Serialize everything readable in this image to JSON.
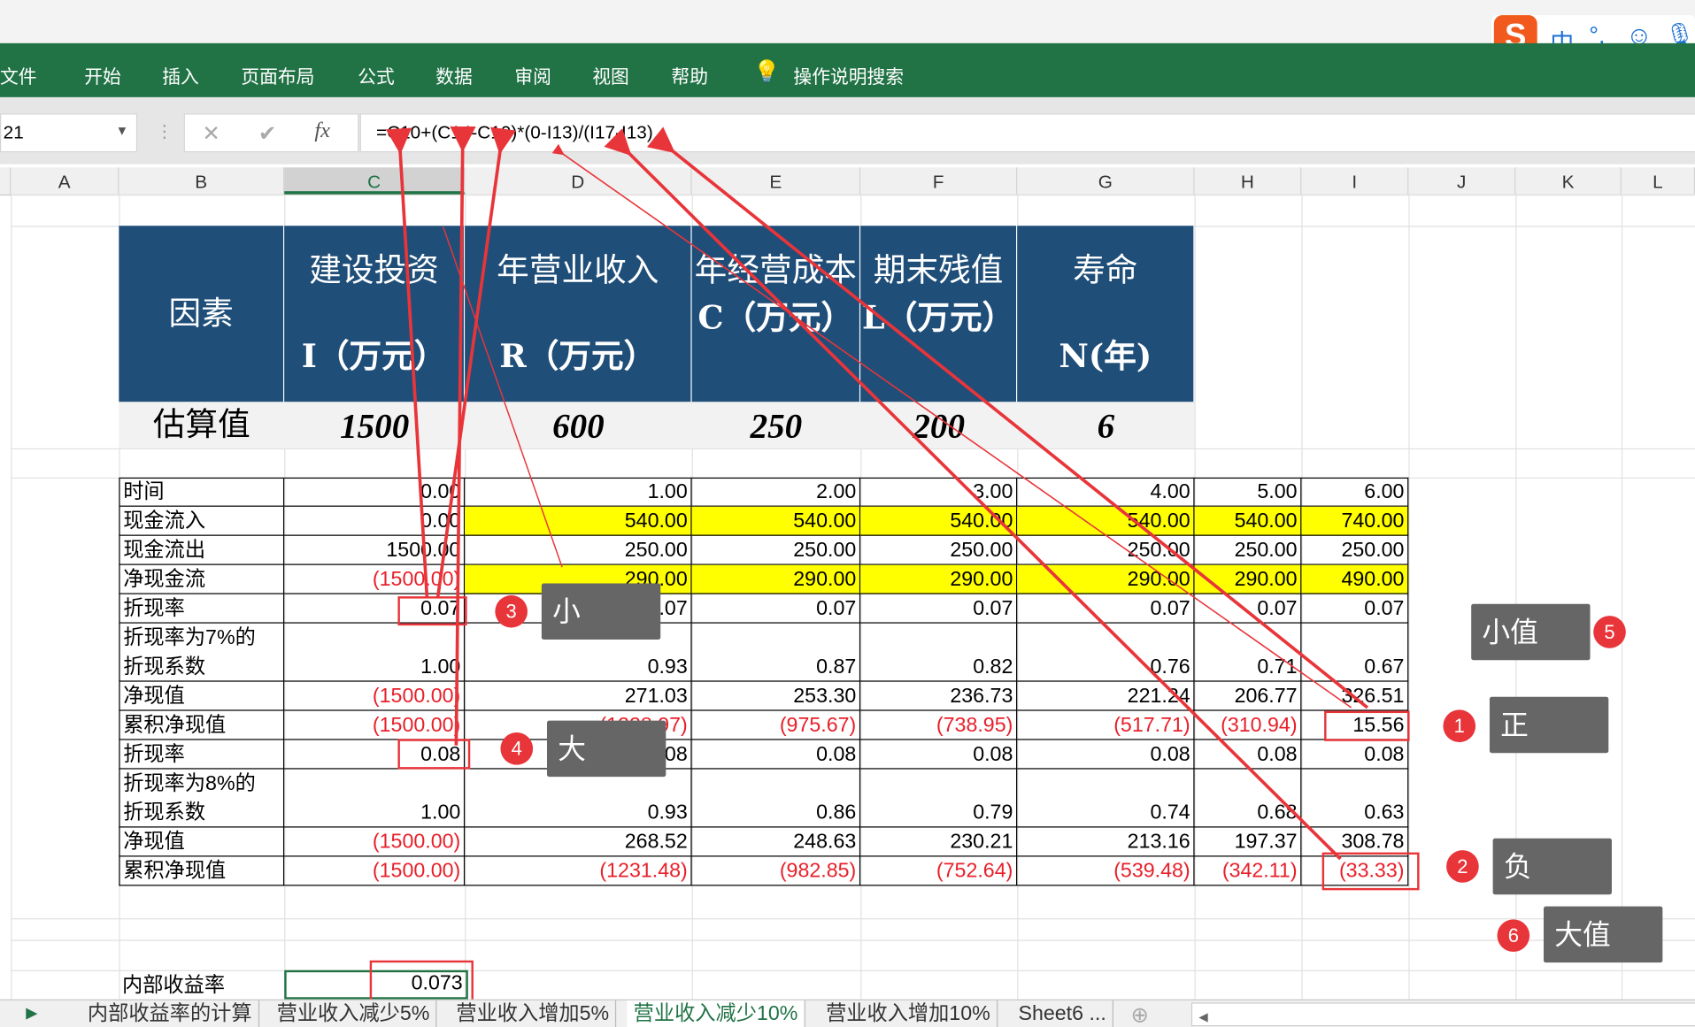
{
  "ribbon": {
    "tabs": [
      "文件",
      "开始",
      "插入",
      "页面布局",
      "公式",
      "数据",
      "审阅",
      "视图",
      "帮助"
    ],
    "search": "操作说明搜索"
  },
  "ime": {
    "lang": "中",
    "punct": "°,"
  },
  "formula_bar": {
    "name_box": "21",
    "cancel": "✕",
    "enter": "✔",
    "fx": "fx",
    "formula": "=C10+(C14-C10)*(0-I13)/(I17-I13)"
  },
  "columns": [
    "A",
    "B",
    "C",
    "D",
    "E",
    "F",
    "G",
    "H",
    "I",
    "J",
    "K",
    "L"
  ],
  "factors": {
    "label": "因素",
    "headers": [
      [
        "建设投资",
        "I（万元）"
      ],
      [
        "年营业收入",
        "R（万元）"
      ],
      [
        "年经营成本",
        "C（万元）"
      ],
      [
        "期末残值",
        "L（万元）"
      ],
      [
        "寿命",
        "N(年)"
      ]
    ],
    "estimate_label": "估算值",
    "estimates": [
      "1500",
      "600",
      "250",
      "200",
      "6"
    ]
  },
  "table": [
    {
      "label": [
        "时间"
      ],
      "values": [
        "0.00",
        "1.00",
        "2.00",
        "3.00",
        "4.00",
        "5.00",
        "6.00"
      ]
    },
    {
      "label": [
        "现金流入"
      ],
      "values": [
        "0.00",
        "540.00",
        "540.00",
        "540.00",
        "540.00",
        "540.00",
        "740.00"
      ],
      "yellow": true
    },
    {
      "label": [
        "现金流出"
      ],
      "values": [
        "1500.00",
        "250.00",
        "250.00",
        "250.00",
        "250.00",
        "250.00",
        "250.00"
      ]
    },
    {
      "label": [
        "净现金流"
      ],
      "values": [
        "(1500.00)",
        "290.00",
        "290.00",
        "290.00",
        "290.00",
        "290.00",
        "490.00"
      ],
      "yellow": true
    },
    {
      "label": [
        "折现率"
      ],
      "values": [
        "0.07",
        "0.07",
        "0.07",
        "0.07",
        "0.07",
        "0.07",
        "0.07"
      ]
    },
    {
      "label": [
        "折现率为7%的",
        "折现系数"
      ],
      "values": [
        "1.00",
        "0.93",
        "0.87",
        "0.82",
        "0.76",
        "0.71",
        "0.67"
      ],
      "tall": true
    },
    {
      "label": [
        "净现值"
      ],
      "values": [
        "(1500.00)",
        "271.03",
        "253.30",
        "236.73",
        "221.24",
        "206.77",
        "326.51"
      ]
    },
    {
      "label": [
        "累积净现值"
      ],
      "values": [
        "(1500.00)",
        "(1228.97)",
        "(975.67)",
        "(738.95)",
        "(517.71)",
        "(310.94)",
        "15.56"
      ]
    },
    {
      "label": [
        "折现率"
      ],
      "values": [
        "0.08",
        "0.08",
        "0.08",
        "0.08",
        "0.08",
        "0.08",
        "0.08"
      ]
    },
    {
      "label": [
        "折现率为8%的",
        "折现系数"
      ],
      "values": [
        "1.00",
        "0.93",
        "0.86",
        "0.79",
        "0.74",
        "0.68",
        "0.63"
      ],
      "tall": true
    },
    {
      "label": [
        "净现值"
      ],
      "values": [
        "(1500.00)",
        "268.52",
        "248.63",
        "230.21",
        "213.16",
        "197.37",
        "308.78"
      ]
    },
    {
      "label": [
        "累积净现值"
      ],
      "values": [
        "(1500.00)",
        "(1231.48)",
        "(982.85)",
        "(752.64)",
        "(539.48)",
        "(342.11)",
        "(33.33)"
      ]
    }
  ],
  "irr": {
    "label": "内部收益率",
    "value": "0.073"
  },
  "callouts": [
    {
      "num": "1",
      "text": "正"
    },
    {
      "num": "2",
      "text": "负"
    },
    {
      "num": "3",
      "text": "小"
    },
    {
      "num": "4",
      "text": "大"
    },
    {
      "num": "5",
      "text": "小值"
    },
    {
      "num": "6",
      "text": "大值"
    }
  ],
  "sheet_tabs": [
    "内部收益率的计算",
    "营业收入减少5%",
    "营业收入增加5%",
    "营业收入减少10%",
    "营业收入增加10%",
    "Sheet6 ..."
  ],
  "active_sheet": "营业收入减少10%",
  "colors": {
    "excel_green": "#217346",
    "header_blue": "#1f4e79",
    "highlight": "#ffff00",
    "negative": "#e8202a",
    "annotation": "#e8353a"
  }
}
